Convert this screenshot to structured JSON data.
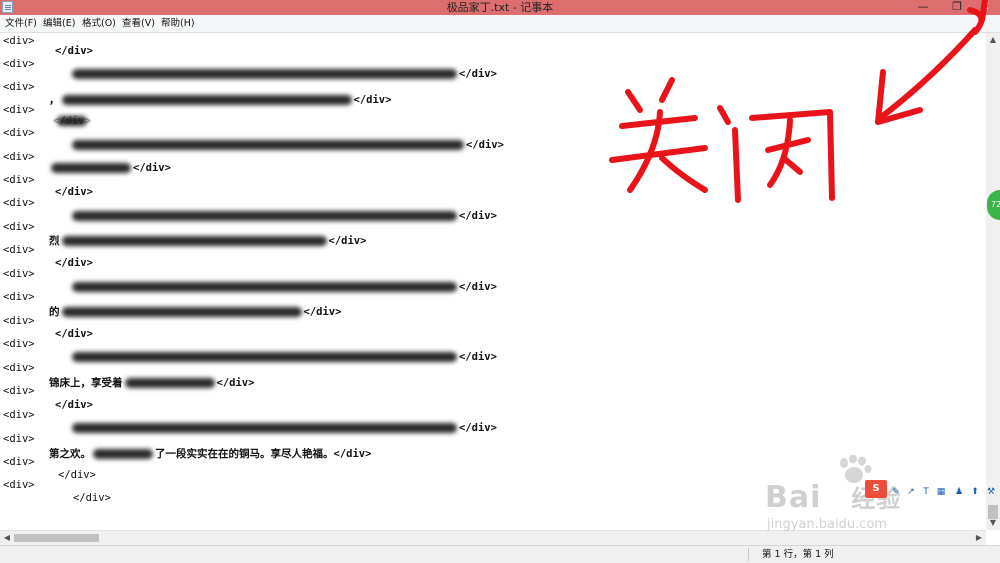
{
  "window": {
    "title": "极品家丁.txt - 记事本",
    "min_glyph": "—",
    "max_glyph": "❐",
    "close_glyph": "✕",
    "icon": "notepad-icon"
  },
  "menu": [
    {
      "label": "文件(F)"
    },
    {
      "label": "编辑(E)"
    },
    {
      "label": "格式(O)"
    },
    {
      "label": "查看(V)"
    },
    {
      "label": "帮助(H)"
    }
  ],
  "gutter": [
    "<div>",
    "<div>",
    "<div>",
    "<div>",
    "<div>",
    "<div>",
    "<div>",
    "<div>",
    "<div>",
    "<div>",
    "<div>",
    "<div>",
    "<div>",
    "<div>",
    "<div>",
    "<div>",
    "<div>",
    "<div>",
    "<div>",
    "<div>"
  ],
  "lines": {
    "l1_tag": "</div>",
    "l2_tag": "</div>",
    "l3_lead": "，",
    "l3_tag": "</div>",
    "l4_tag": "</div>",
    "l5_tag": "</div>",
    "l6_tag": "</div>",
    "l7_tag": "</div>",
    "l8_tag": "</div>",
    "l9_lead": "烈",
    "l9_tag": "</div>",
    "l10_tag": "</div>",
    "l11_tag": "</div>",
    "l12_lead": "的",
    "l12_tag": "</div>",
    "l13_tag": "</div>",
    "l14_tag": "</div>",
    "l15_lead": "锦床上，享受着",
    "l15_tag": "</div>",
    "l16_tag": "</div>",
    "l17_tag": "</div>",
    "l18_lead": "第之欢。",
    "l18_mid": "了一段实实在在的铜马。享尽人艳福。",
    "l18_tag": "</div>",
    "l19_tag": "</div>",
    "l20_tag": "</div>"
  },
  "status": {
    "position": "第 1 行，第 1 列"
  },
  "annotation": {
    "text_chars": "关闭",
    "color": "#e8141a"
  },
  "side_badge": {
    "text": "72"
  },
  "watermark": {
    "brand": "Bai",
    "brand_suffix": "经验",
    "url": "jingyan.baidu.com",
    "logo": "baidu-paw-icon"
  },
  "tool_tray": [
    "pen-icon",
    "arrow-icon",
    "text-icon",
    "grid-icon",
    "people-icon",
    "upload-icon",
    "wrench-icon"
  ],
  "colors": {
    "titlebar": "#dd6e6e",
    "annotation_red": "#e8141a",
    "badge_green": "#3bb54a"
  }
}
